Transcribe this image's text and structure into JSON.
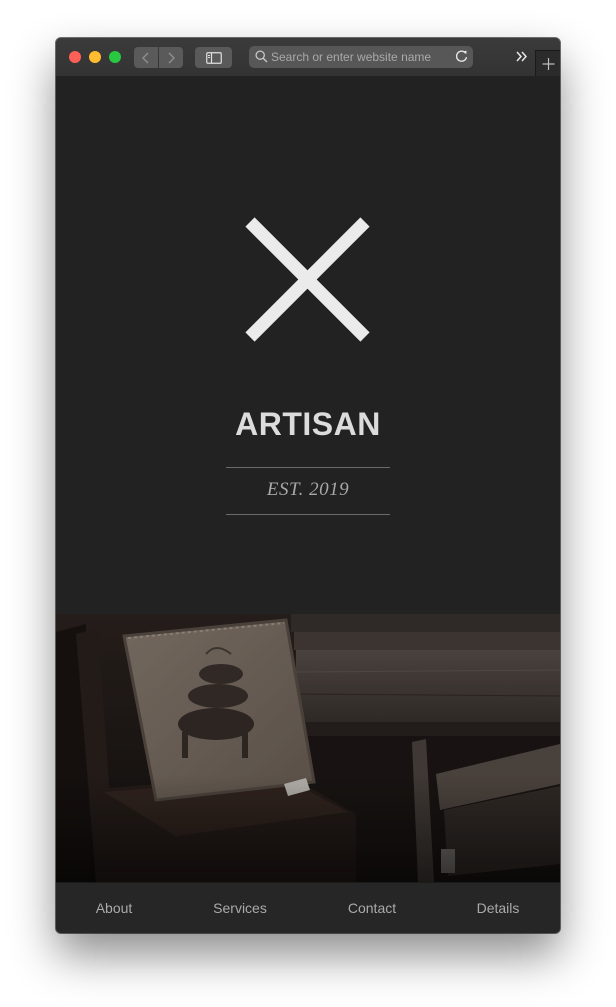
{
  "browser": {
    "search_placeholder": "Search or enter website name",
    "icons": [
      "back-icon",
      "forward-icon",
      "sidebar-icon",
      "search-icon",
      "reload-icon",
      "overflow-chevron-icon",
      "plus-icon"
    ],
    "traffic_lights": {
      "close": "#fe5f57",
      "minimize": "#febc2e",
      "zoom": "#28c840"
    }
  },
  "hero": {
    "logo_icon": "x-mark-icon",
    "brand": "ARTISAN",
    "established": "EST. 2019",
    "background": "#222222",
    "text_color": "#dcdcdc"
  },
  "photo": {
    "subject": "embroidered pillow on a vintage chair"
  },
  "footer_nav": {
    "items": [
      {
        "label": "About"
      },
      {
        "label": "Services"
      },
      {
        "label": "Contact"
      },
      {
        "label": "Details"
      }
    ]
  }
}
